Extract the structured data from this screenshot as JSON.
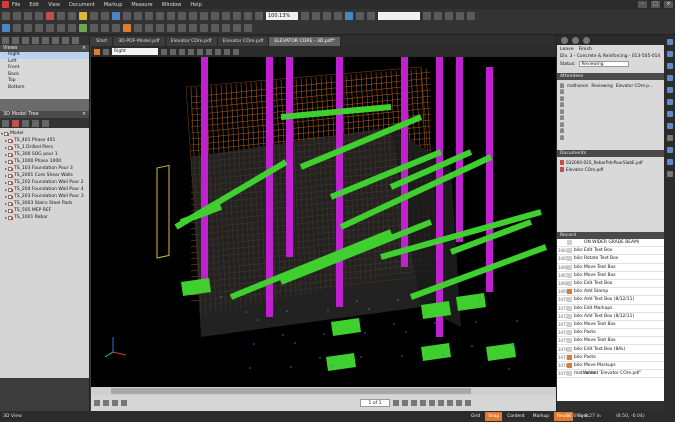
{
  "menu": [
    "File",
    "Edit",
    "View",
    "Document",
    "Markup",
    "Measure",
    "Window",
    "Help"
  ],
  "toolbar": {
    "zoom": "100.13%"
  },
  "tabs": [
    {
      "label": "Start",
      "active": false
    },
    {
      "label": "3D-PDF-Model.pdf",
      "active": false
    },
    {
      "label": "Elevator COre.pdf",
      "active": false
    },
    {
      "label": "Elevator COre.pdf",
      "active": false
    },
    {
      "label": "ELEVATOR CORE - 3D.pdf*",
      "active": true
    }
  ],
  "views_panel": {
    "title": "Views",
    "items": [
      {
        "label": "Right",
        "selected": true
      },
      {
        "label": "Left",
        "selected": false
      },
      {
        "label": "Front",
        "selected": false
      },
      {
        "label": "Back",
        "selected": false
      },
      {
        "label": "Top",
        "selected": false
      },
      {
        "label": "Bottom",
        "selected": false
      }
    ]
  },
  "model_tree": {
    "title": "3D Model Tree",
    "root": "Model",
    "items": [
      "TS_401 Phase 401",
      "TS_1 Drilled Piers",
      "TS_300 SOG pour 1",
      "TS_1000 Phase 1000",
      "TS_103 Foundation Pour 3",
      "TS_2001 Core Shear Walls",
      "TS_202 Foundation Wall Pour 2",
      "TS_204 Foundation Wall Pour 4",
      "TS_203 Foundation Wall Pour 3",
      "TS_3003 Stairs Steel Pads",
      "TS_505 MEP REF",
      "TS_1001 Rebar"
    ]
  },
  "viewbar": {
    "view_select": "Right"
  },
  "navbar": {
    "page": "1 of 1"
  },
  "session": {
    "leave_label": "Leave",
    "finish_label": "Finish",
    "name": "Div. 3 - Concrete & Reinforcing - 013-505-014",
    "status_label": "Status:",
    "status_value": "Reviewing",
    "attendees_title": "Attendees",
    "attendees": [
      {
        "name": "mathanon",
        "status": "Reviewing",
        "doc": "Elevator COre.p...",
        "faded": false
      },
      {
        "name": "",
        "status": "",
        "doc": "",
        "faded": true
      },
      {
        "name": "",
        "status": "",
        "doc": "",
        "faded": true
      },
      {
        "name": "",
        "status": "",
        "doc": "",
        "faded": true
      },
      {
        "name": "",
        "status": "",
        "doc": "",
        "faded": true
      },
      {
        "name": "",
        "status": "",
        "doc": "",
        "faded": true
      },
      {
        "name": "",
        "status": "",
        "doc": "",
        "faded": true
      },
      {
        "name": "",
        "status": "",
        "doc": "",
        "faded": true
      },
      {
        "name": "",
        "status": "",
        "doc": "",
        "faded": true
      }
    ],
    "documents_title": "Documents",
    "documents": [
      "032000-02S_RebarPdnPourSlabE.pdf",
      "Elevator COre.pdf"
    ],
    "record_title": "Record",
    "record": [
      {
        "num": "",
        "who": "",
        "action": "ON WIDER GRADE BEAM)",
        "markup": false
      },
      {
        "num": "3464",
        "who": "bilo:",
        "action": "Edit Text Box",
        "markup": false
      },
      {
        "num": "3465",
        "who": "bilo:",
        "action": "Rotate Text Box",
        "markup": false
      },
      {
        "num": "3466",
        "who": "bilo:",
        "action": "Move Text Box",
        "markup": false
      },
      {
        "num": "3467",
        "who": "bilo:",
        "action": "Move Text Box",
        "markup": false
      },
      {
        "num": "3468",
        "who": "bilo:",
        "action": "Edit Text Box",
        "markup": false
      },
      {
        "num": "3469",
        "who": "bilo:",
        "action": "Add Stamp",
        "markup": true
      },
      {
        "num": "3470",
        "who": "bilo:",
        "action": "Add Text Box (8/12/11)",
        "markup": false
      },
      {
        "num": "3471",
        "who": "bilo:",
        "action": "Edit Markups",
        "markup": false
      },
      {
        "num": "3472",
        "who": "bilo:",
        "action": "Add Text Box (8/12/11)",
        "markup": false
      },
      {
        "num": "3473",
        "who": "bilo:",
        "action": "Move Text Box",
        "markup": false
      },
      {
        "num": "3474",
        "who": "bilo:",
        "action": "Paste",
        "markup": false
      },
      {
        "num": "3475",
        "who": "bilo:",
        "action": "Move Text Box",
        "markup": false
      },
      {
        "num": "3476",
        "who": "bilo:",
        "action": "Edit Text Box (8AL)",
        "markup": false
      },
      {
        "num": "3477",
        "who": "bilo:",
        "action": "Paste",
        "markup": true
      },
      {
        "num": "3478",
        "who": "bilo:",
        "action": "Move Markups",
        "markup": true
      },
      {
        "num": "3479",
        "who": "mathanon:",
        "action": "Added 'Elevator COre.pdf'",
        "markup": false
      }
    ]
  },
  "statusbar": {
    "view_label": "3D View",
    "toggles": [
      {
        "label": "Grid",
        "on": false
      },
      {
        "label": "Snap",
        "on": true
      },
      {
        "label": "Content",
        "on": false
      },
      {
        "label": "Markup",
        "on": false
      },
      {
        "label": "Reuse",
        "on": true
      },
      {
        "label": "Sync",
        "on": false
      }
    ],
    "dimensions": "11.69 x 8.27 in",
    "coords": "(8.50, -0.04)"
  },
  "colors": {
    "accent": "#e07a2f",
    "beam": "#3fcf2f",
    "column": "#c020d0",
    "rebar": "#c96a1f",
    "background": "#000000"
  }
}
